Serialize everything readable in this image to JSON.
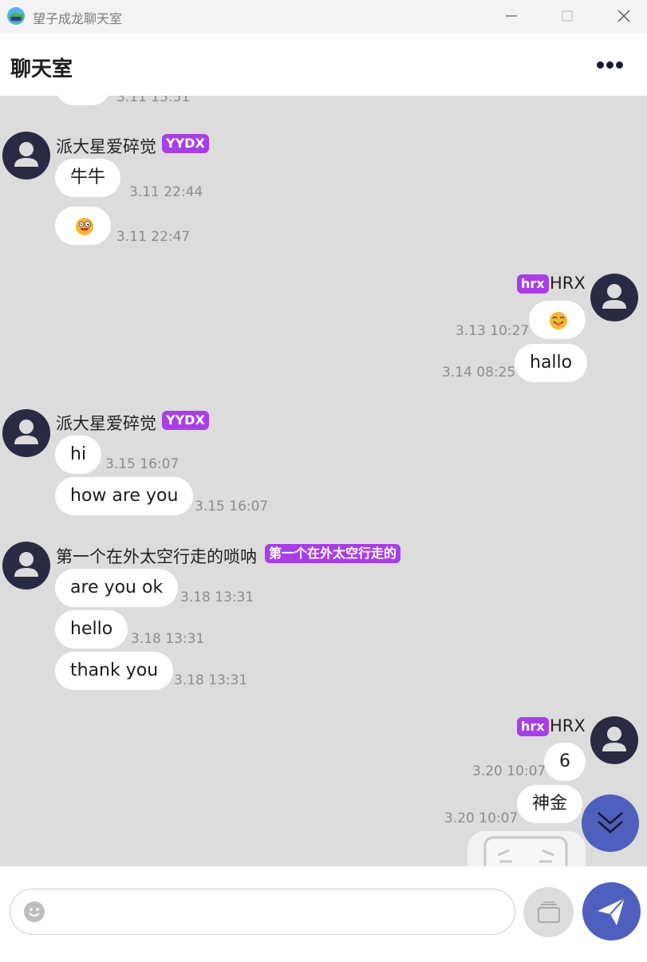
{
  "window": {
    "title": "望子成龙聊天室"
  },
  "header": {
    "title": "聊天室"
  },
  "composer": {
    "placeholder": ""
  },
  "colors": {
    "accent": "#4e5fbe",
    "badge": "#a83ee6",
    "chat_bg": "#dcdcdc",
    "avatar": "#2a2a42"
  },
  "icons": {
    "app": "app-logo-icon",
    "minimize": "minimize-icon",
    "maximize": "maximize-icon",
    "close": "close-icon",
    "more": "more-dots-icon",
    "scroll": "chevron-double-down-icon",
    "emoji": "smiley-icon",
    "image": "image-icon",
    "send": "paper-plane-icon"
  },
  "messages": {
    "top_partial": {
      "time": "3.11 15:51"
    },
    "g1": {
      "name": "派大星爱碎觉",
      "badge": "YYDX",
      "m1": {
        "text": "牛牛",
        "time": "3.11 22:44"
      },
      "m2": {
        "emoji": "zany-face",
        "time": "3.11 22:47"
      }
    },
    "g2": {
      "name": "HRX",
      "badge": "hrx",
      "m1": {
        "emoji": "face-with-tongue",
        "time": "3.13 10:27"
      },
      "m2": {
        "text": "hallo",
        "time": "3.14 08:25"
      }
    },
    "g3": {
      "name": "派大星爱碎觉",
      "badge": "YYDX",
      "m1": {
        "text": "hi",
        "time": "3.15 16:07"
      },
      "m2": {
        "text": "how are you",
        "time": "3.15 16:07"
      }
    },
    "g4": {
      "name": "第一个在外太空行走的唢呐",
      "badge": "第一个在外太空行走的",
      "m1": {
        "text": "are you ok",
        "time": "3.18 13:31"
      },
      "m2": {
        "text": "hello",
        "time": "3.18 13:31"
      },
      "m3": {
        "text": "thank you",
        "time": "3.18 13:31"
      }
    },
    "g5": {
      "name": "HRX",
      "badge": "hrx",
      "m1": {
        "text": "6",
        "time": "3.20 10:07"
      },
      "m2": {
        "text": "神金",
        "time": "3.20 10:07"
      },
      "m3": {
        "sticker": "sticker-image"
      }
    }
  }
}
